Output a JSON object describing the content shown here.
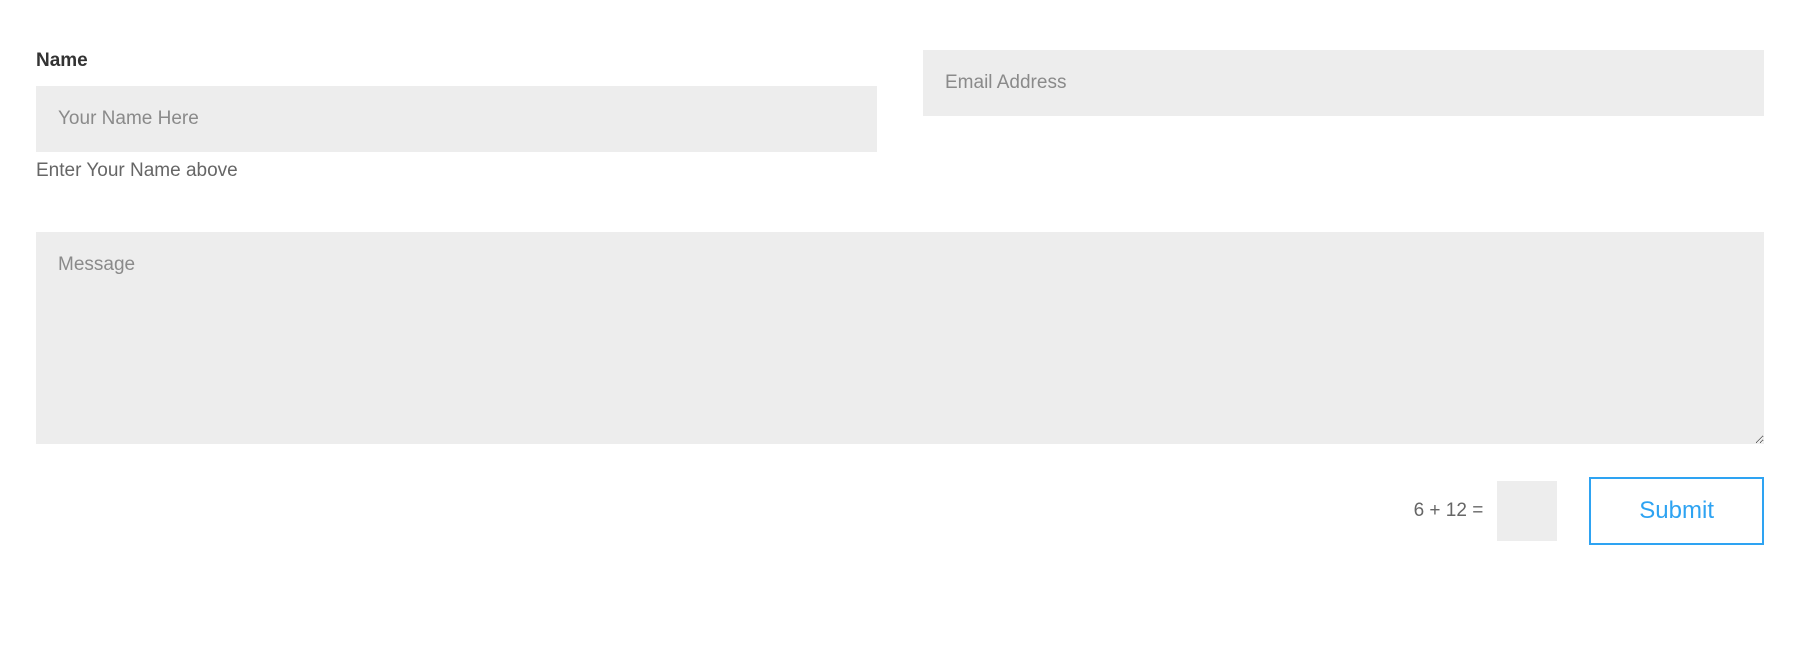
{
  "form": {
    "name": {
      "label": "Name",
      "placeholder": "Your Name Here",
      "help": "Enter Your Name above"
    },
    "email": {
      "placeholder": "Email Address"
    },
    "message": {
      "placeholder": "Message"
    },
    "captcha": {
      "question": "6 + 12 ="
    },
    "submit": {
      "label": "Submit"
    }
  }
}
